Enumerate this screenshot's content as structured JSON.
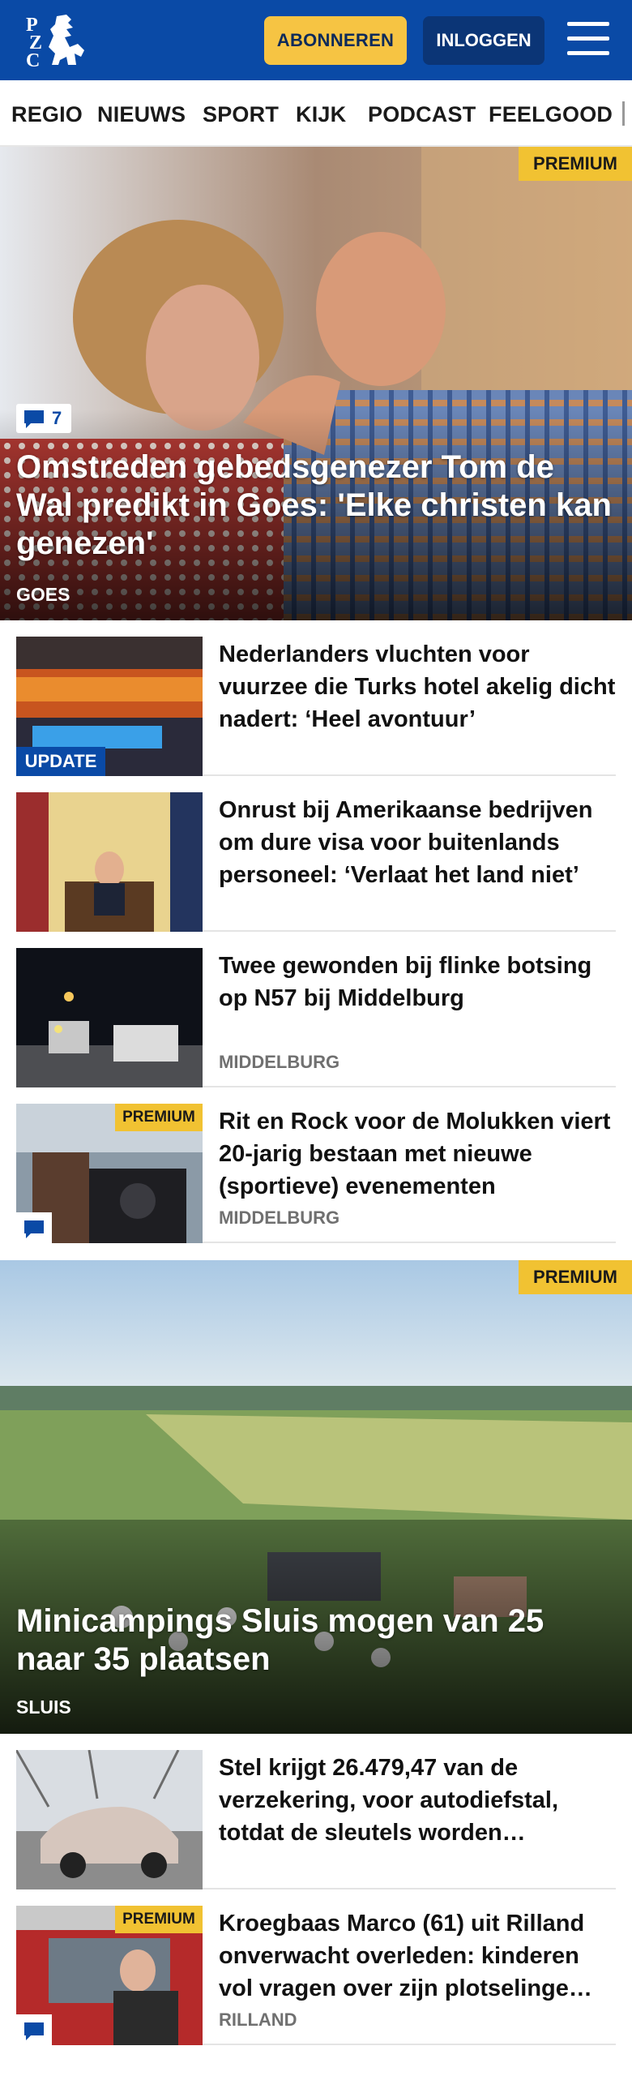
{
  "header": {
    "subscribe_label": "ABONNEREN",
    "login_label": "INLOGGEN",
    "brand_color": "#0a4aa6",
    "accent_color": "#f6c443",
    "logo_text": "PZC"
  },
  "nav": {
    "items": [
      {
        "label": "REGIO"
      },
      {
        "label": "NIEUWS"
      },
      {
        "label": "SPORT"
      },
      {
        "label": "KIJK"
      },
      {
        "label": "PODCAST"
      },
      {
        "label": "FEELGOOD"
      }
    ]
  },
  "hero1": {
    "badge": "PREMIUM",
    "comment_count": "7",
    "title": "Omstreden gebedsgenezer Tom de Wal predikt in Goes: 'Elke christen kan genezen'",
    "location": "GOES"
  },
  "articles1": [
    {
      "title": "Nederlanders vluchten voor vuurzee die Turks hotel akelig dicht nadert: ‘Heel avontuur’",
      "badge": "UPDATE",
      "location": ""
    },
    {
      "title": "Onrust bij Amerikaanse bedrijven om dure visa voor buitenlands personeel: ‘Verlaat het land niet’",
      "location": ""
    },
    {
      "title": "Twee gewonden bij flinke botsing op N57 bij Middelburg",
      "location": "MIDDELBURG"
    },
    {
      "title": "Rit en Rock voor de Molukken viert 20-jarig bestaan met nieuwe (sportieve) evenementen",
      "badge": "PREMIUM",
      "location": "MIDDELBURG"
    }
  ],
  "hero2": {
    "badge": "PREMIUM",
    "title": "Minicampings Sluis mogen van 25 naar 35 plaatsen",
    "location": "SLUIS"
  },
  "articles2": [
    {
      "title": "Stel krijgt 26.479,47 van de verzekering, voor autodiefstal, totdat de sleutels worden…",
      "location": ""
    },
    {
      "title": "Kroegbaas Marco (61) uit Rilland onverwacht overleden: kinderen vol vragen over zijn plotselinge…",
      "badge": "PREMIUM",
      "location": "RILLAND"
    }
  ],
  "icons": [
    "hamburger-menu-icon",
    "comment-icon",
    "logo-lion-icon"
  ]
}
